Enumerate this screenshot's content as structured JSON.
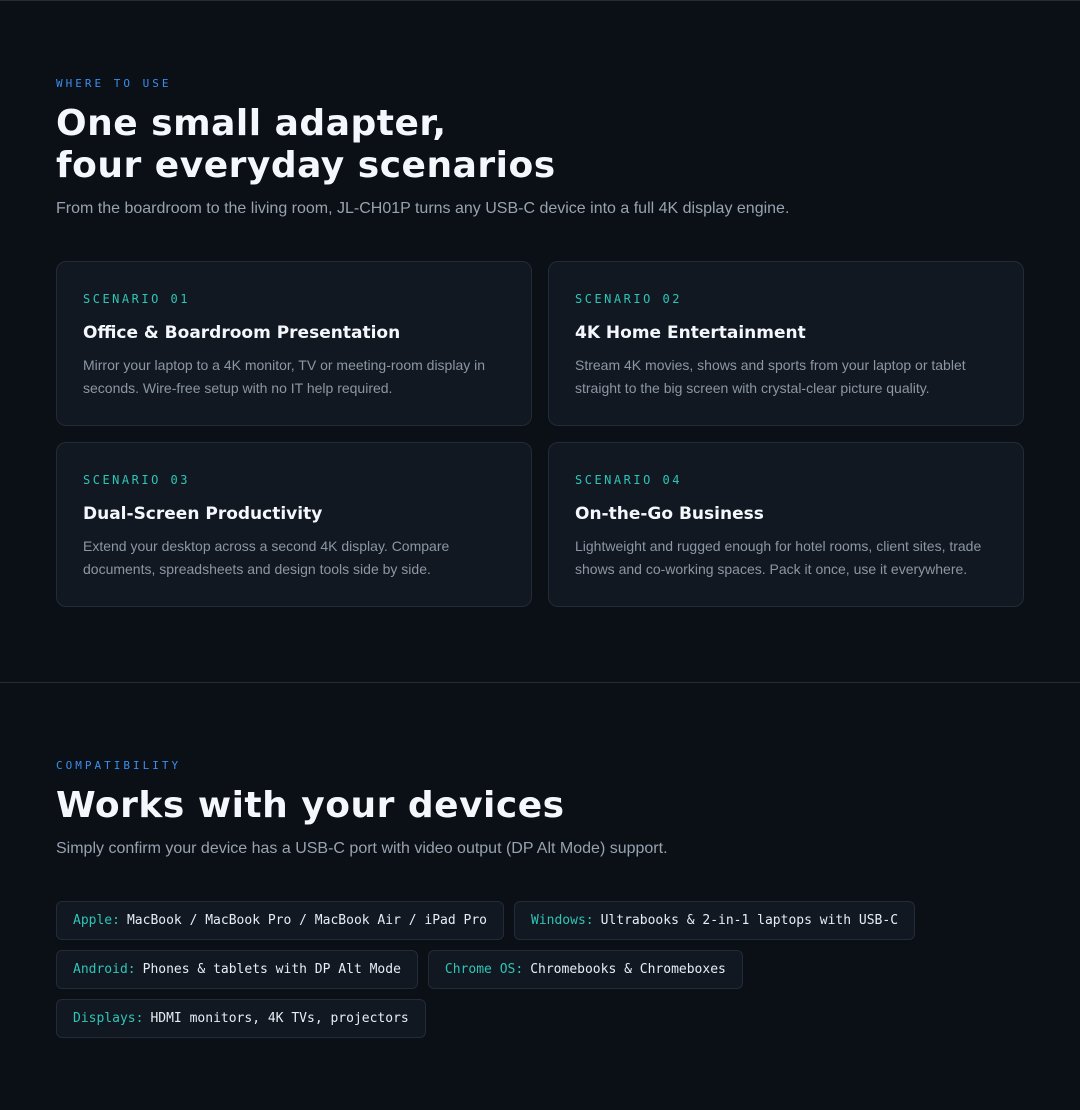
{
  "usage": {
    "eyebrow": "WHERE TO USE",
    "heading_line1": "One small adapter,",
    "heading_line2": "four everyday scenarios",
    "lead": "From the boardroom to the living room, JL-CH01P turns any USB-C device into a full 4K display engine.",
    "cards": [
      {
        "tag": "SCENARIO 01",
        "title": "Office & Boardroom Presentation",
        "text": "Mirror your laptop to a 4K monitor, TV or meeting-room display in seconds. Wire-free setup with no IT help required."
      },
      {
        "tag": "SCENARIO 02",
        "title": "4K Home Entertainment",
        "text": "Stream 4K movies, shows and sports from your laptop or tablet straight to the big screen with crystal-clear picture quality."
      },
      {
        "tag": "SCENARIO 03",
        "title": "Dual-Screen Productivity",
        "text": "Extend your desktop across a second 4K display. Compare documents, spreadsheets and design tools side by side."
      },
      {
        "tag": "SCENARIO 04",
        "title": "On-the-Go Business",
        "text": "Lightweight and rugged enough for hotel rooms, client sites, trade shows and co-working spaces. Pack it once, use it everywhere."
      }
    ]
  },
  "compatibility": {
    "eyebrow": "COMPATIBILITY",
    "heading": "Works with your devices",
    "lead": "Simply confirm your device has a USB-C port with video output (DP Alt Mode) support.",
    "chips": [
      {
        "label": "Apple:",
        "value": "MacBook / MacBook Pro / MacBook Air / iPad Pro"
      },
      {
        "label": "Windows:",
        "value": "Ultrabooks & 2-in-1 laptops with USB-C"
      },
      {
        "label": "Android:",
        "value": "Phones & tablets with DP Alt Mode"
      },
      {
        "label": "Chrome OS:",
        "value": "Chromebooks & Chromeboxes"
      },
      {
        "label": "Displays:",
        "value": "HDMI monitors, 4K TVs, projectors"
      }
    ]
  },
  "colors": {
    "background": "#0b0f16",
    "card": "#111821",
    "eyebrow_blue": "#3b8ef0",
    "accent_teal": "#2ec4b6"
  }
}
